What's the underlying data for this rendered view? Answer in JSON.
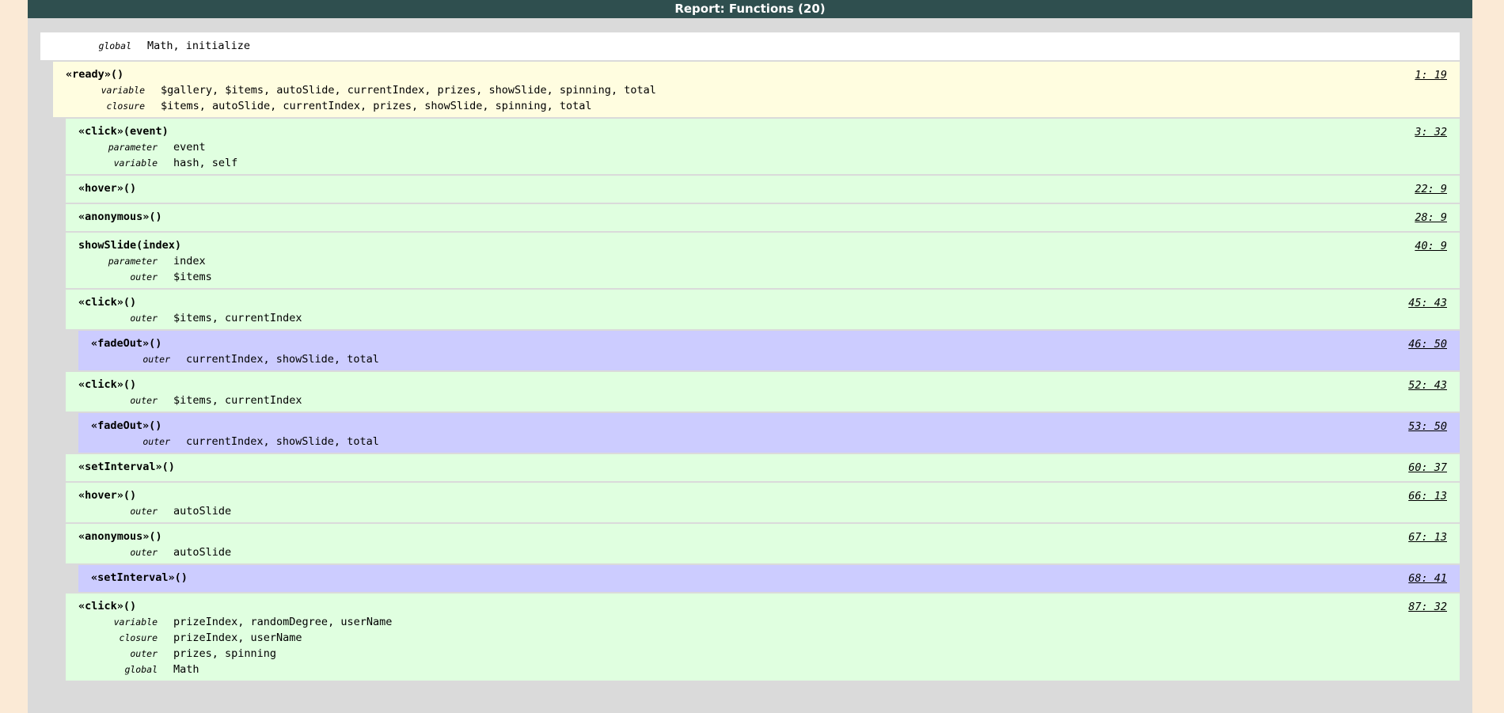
{
  "header": {
    "title": "Report: Functions (20)"
  },
  "global": {
    "kind": "global",
    "names": "Math, initialize"
  },
  "functions": [
    {
      "title": "«ready»()",
      "location": "1: 19",
      "rows": [
        {
          "kind": "variable",
          "names": "$gallery, $items, autoSlide, currentIndex, prizes, showSlide, spinning, total"
        },
        {
          "kind": "closure",
          "names": "$items, autoSlide, currentIndex, prizes, showSlide, spinning, total"
        }
      ]
    },
    {
      "title": "«click»(event)",
      "location": "3: 32",
      "rows": [
        {
          "kind": "parameter",
          "names": "event"
        },
        {
          "kind": "variable",
          "names": "hash, self"
        }
      ]
    },
    {
      "title": "«hover»()",
      "location": "22: 9",
      "rows": []
    },
    {
      "title": "«anonymous»()",
      "location": "28: 9",
      "rows": []
    },
    {
      "title": "showSlide(index)",
      "location": "40: 9",
      "rows": [
        {
          "kind": "parameter",
          "names": "index"
        },
        {
          "kind": "outer",
          "names": "$items"
        }
      ]
    },
    {
      "title": "«click»()",
      "location": "45: 43",
      "rows": [
        {
          "kind": "outer",
          "names": "$items, currentIndex"
        }
      ]
    },
    {
      "title": "«fadeOut»()",
      "location": "46: 50",
      "rows": [
        {
          "kind": "outer",
          "names": "currentIndex, showSlide, total"
        }
      ]
    },
    {
      "title": "«click»()",
      "location": "52: 43",
      "rows": [
        {
          "kind": "outer",
          "names": "$items, currentIndex"
        }
      ]
    },
    {
      "title": "«fadeOut»()",
      "location": "53: 50",
      "rows": [
        {
          "kind": "outer",
          "names": "currentIndex, showSlide, total"
        }
      ]
    },
    {
      "title": "«setInterval»()",
      "location": "60: 37",
      "rows": []
    },
    {
      "title": "«hover»()",
      "location": "66: 13",
      "rows": [
        {
          "kind": "outer",
          "names": "autoSlide"
        }
      ]
    },
    {
      "title": "«anonymous»()",
      "location": "67: 13",
      "rows": [
        {
          "kind": "outer",
          "names": "autoSlide"
        }
      ]
    },
    {
      "title": "«setInterval»()",
      "location": "68: 41",
      "rows": []
    },
    {
      "title": "«click»()",
      "location": "87: 32",
      "rows": [
        {
          "kind": "variable",
          "names": "prizeIndex, randomDegree, userName"
        },
        {
          "kind": "closure",
          "names": "prizeIndex, userName"
        },
        {
          "kind": "outer",
          "names": "prizes, spinning"
        },
        {
          "kind": "global",
          "names": "Math"
        }
      ]
    }
  ],
  "colors": {
    "page_background": "#fbead6",
    "header_background": "#2f4f4f",
    "level1_background": "#fffde0",
    "level2_background": "#e0ffe0",
    "level3_background": "#ccccff"
  }
}
